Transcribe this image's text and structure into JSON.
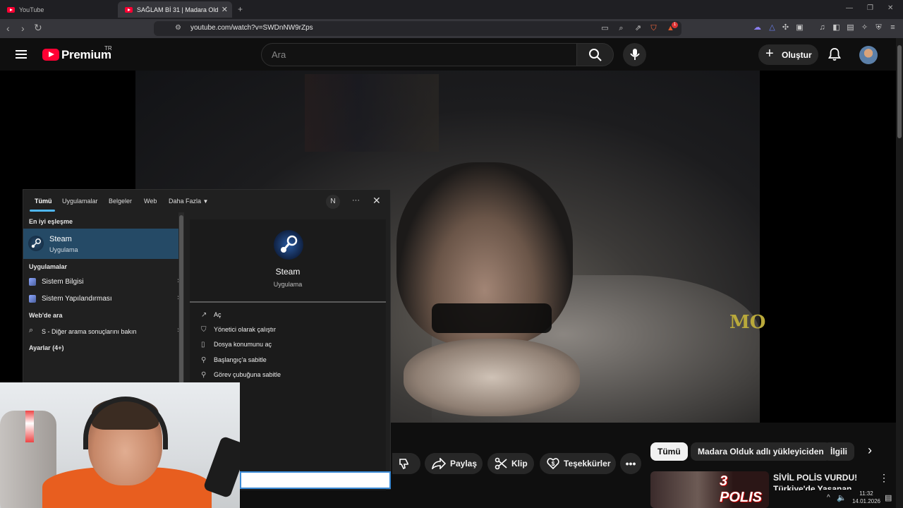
{
  "browser": {
    "tabs": [
      {
        "label": "YouTube"
      },
      {
        "label": "SAĞLAM Bİ 31 | Madara Olduk #"
      }
    ],
    "new_tab": "+",
    "url": "youtube.com/watch?v=SWDnNW9rZps",
    "notification_count": "1"
  },
  "youtube": {
    "brand": "Premium",
    "country": "TR",
    "search_placeholder": "Ara",
    "create_label": "Oluştur",
    "actions": {
      "share": "Paylaş",
      "clip": "Klip",
      "thanks": "Teşekkürler"
    },
    "chips": [
      "Tümü",
      "Madara Olduk adlı yükleyiciden",
      "İlgili"
    ],
    "recommendation": {
      "thumb_text": "3 POLIS",
      "title": "SİVİL POLİS VURDU! Türkiye'de Yaşanan"
    },
    "watermark": "MO"
  },
  "windows_search": {
    "tabs": [
      "Tümü",
      "Uygulamalar",
      "Belgeler",
      "Web",
      "Daha Fazla"
    ],
    "user_initial": "N",
    "more": "···",
    "close": "✕",
    "best_match_header": "En iyi eşleşme",
    "best_match": {
      "name": "Steam",
      "type": "Uygulama"
    },
    "apps_header": "Uygulamalar",
    "apps": [
      {
        "label": "Sistem Bilgisi"
      },
      {
        "label": "Sistem Yapılandırması"
      }
    ],
    "web_header": "Web'de ara",
    "web_item": "S - Diğer arama sonuçlarını bakın",
    "settings_header": "Ayarlar (4+)",
    "detail": {
      "name": "Steam",
      "type": "Uygulama",
      "actions": [
        "Aç",
        "Yönetici olarak çalıştır",
        "Dosya konumunu aç",
        "Başlangıç'a sabitle",
        "Görev çubuğuna sabitle"
      ]
    }
  },
  "taskbar": {
    "time": "11:32",
    "date": "14.01.2026"
  }
}
